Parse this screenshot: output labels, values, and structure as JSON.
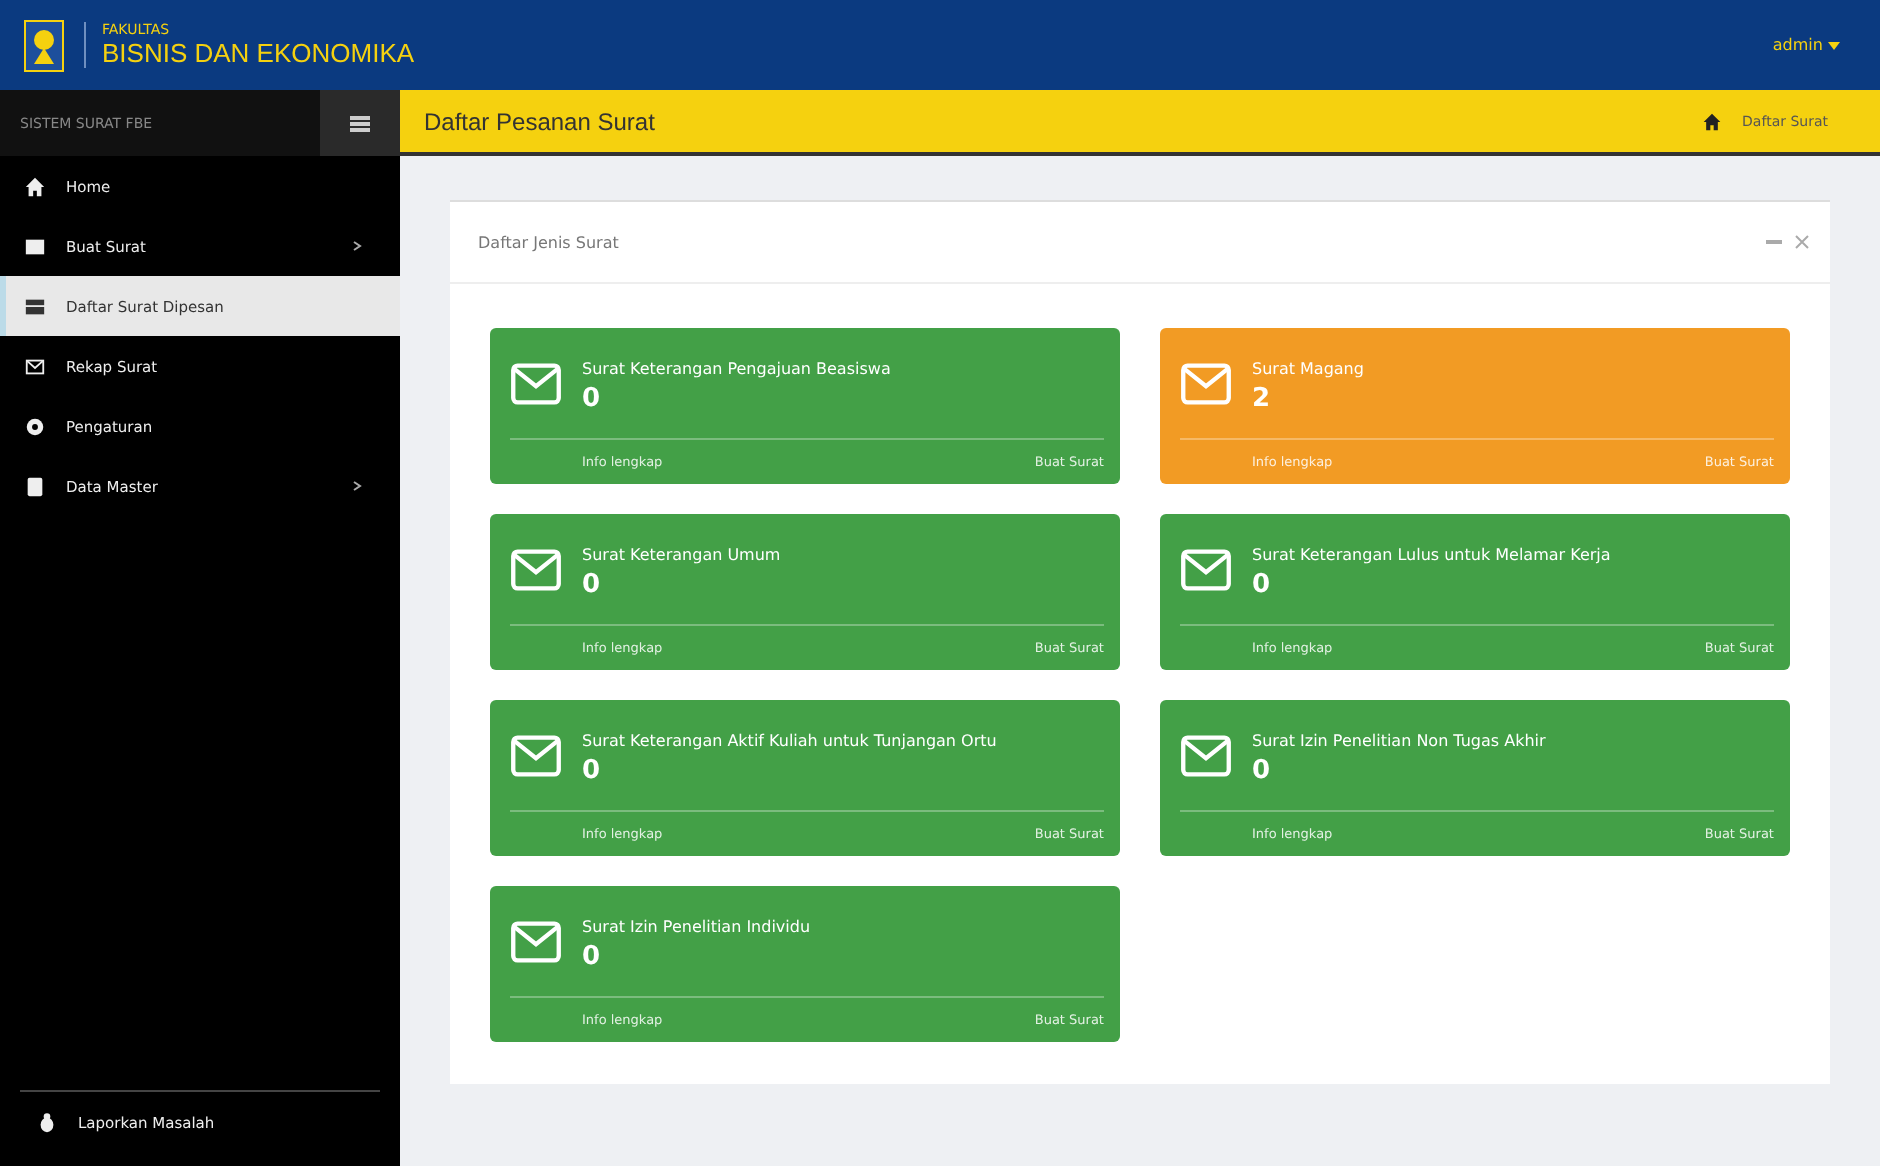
{
  "header": {
    "logo_small": "FAKULTAS",
    "logo_big": "BISNIS DAN EKONOMIKA",
    "user": "admin"
  },
  "sidebar": {
    "title": "SISTEM SURAT FBE",
    "items": [
      {
        "label": "Home",
        "expandable": false,
        "selected": false
      },
      {
        "label": "Buat Surat",
        "expandable": true,
        "selected": false
      },
      {
        "label": "Daftar Surat Dipesan",
        "expandable": false,
        "selected": true
      },
      {
        "label": "Rekap Surat",
        "expandable": false,
        "selected": false
      },
      {
        "label": "Pengaturan",
        "expandable": false,
        "selected": false
      },
      {
        "label": "Data Master",
        "expandable": true,
        "selected": false
      }
    ],
    "footer_item": "Laporkan Masalah"
  },
  "page_title": "Daftar Pesanan Surat",
  "breadcrumb": "Daftar Surat",
  "panel": {
    "title": "Daftar Jenis Surat",
    "cards": [
      {
        "title": "Surat Keterangan Pengajuan Beasiswa",
        "count": "0",
        "left_link": "Info lengkap",
        "right_link": "Buat Surat",
        "color": "#43a047"
      },
      {
        "title": "Surat Magang",
        "count": "2",
        "left_link": "Info lengkap",
        "right_link": "Buat Surat",
        "color": "#f29b24"
      },
      {
        "title": "Surat Keterangan Umum",
        "count": "0",
        "left_link": "Info lengkap",
        "right_link": "Buat Surat",
        "color": "#43a047"
      },
      {
        "title": "Surat Keterangan Lulus untuk Melamar Kerja",
        "count": "0",
        "left_link": "Info lengkap",
        "right_link": "Buat Surat",
        "color": "#43a047"
      },
      {
        "title": "Surat Keterangan Aktif Kuliah untuk Tunjangan Ortu",
        "count": "0",
        "left_link": "Info lengkap",
        "right_link": "Buat Surat",
        "color": "#43a047"
      },
      {
        "title": "Surat Izin Penelitian Non Tugas Akhir",
        "count": "0",
        "left_link": "Info lengkap",
        "right_link": "Buat Surat",
        "color": "#43a047"
      },
      {
        "title": "Surat Izin Penelitian Individu",
        "count": "0",
        "left_link": "Info lengkap",
        "right_link": "Buat Surat",
        "color": "#43a047"
      }
    ]
  }
}
